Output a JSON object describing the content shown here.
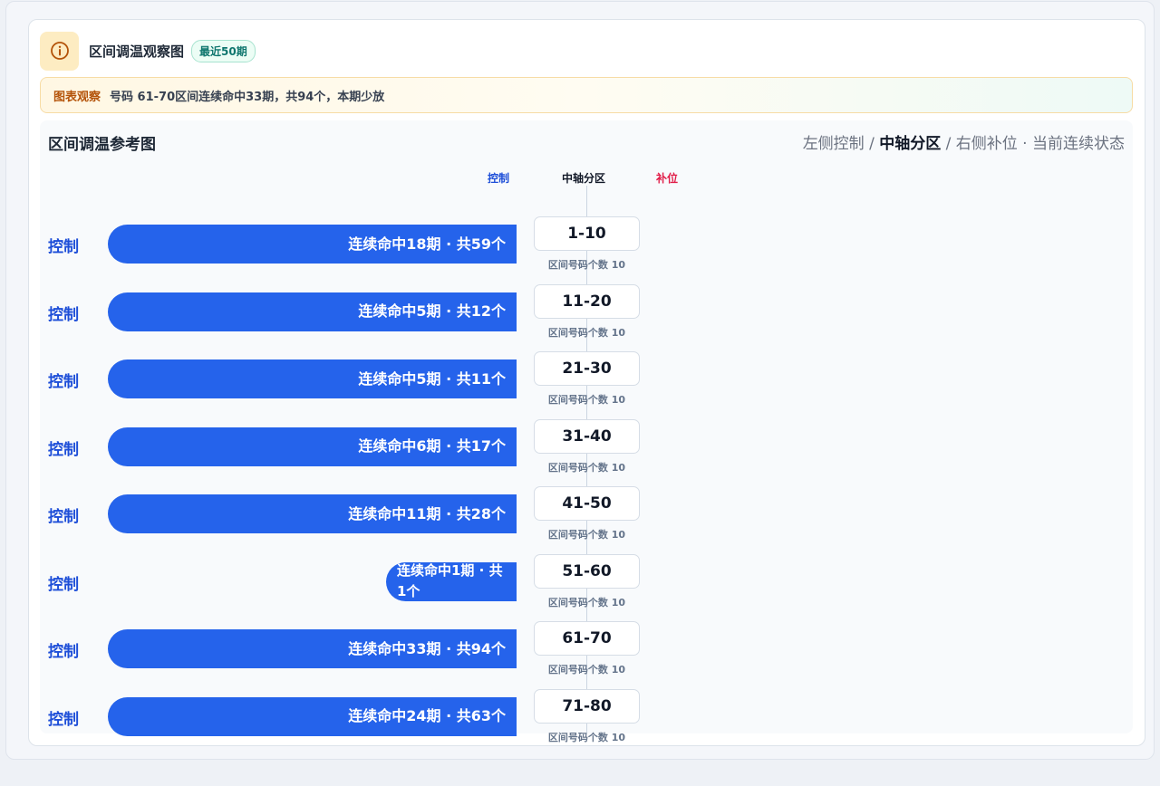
{
  "header": {
    "title": "区间调温观察图",
    "badge": "最近50期",
    "icon": "info-icon"
  },
  "observation": {
    "tag": "图表观察",
    "text": "号码 61-70区间连续命中33期，共94个，本期少放"
  },
  "panel": {
    "title": "区间调温参考图",
    "legend": {
      "left": "左侧控制",
      "sep1": " / ",
      "mid": "中轴分区",
      "sep2": " / ",
      "right": "右侧补位",
      "dot": " · ",
      "state": "当前连续状态"
    },
    "columns": {
      "left": "控制",
      "mid": "中轴分区",
      "right": "补位"
    }
  },
  "colors": {
    "control": "#2563eb",
    "control_text": "#1d4ed8",
    "fill": "#e11d48"
  },
  "rows": [
    {
      "label": "控制",
      "bar_text": "连续命中18期 · 共59个",
      "periods": 18,
      "range": "1-10",
      "count_text": "区间号码个数 10"
    },
    {
      "label": "控制",
      "bar_text": "连续命中5期 · 共12个",
      "periods": 5,
      "range": "11-20",
      "count_text": "区间号码个数 10"
    },
    {
      "label": "控制",
      "bar_text": "连续命中5期 · 共11个",
      "periods": 5,
      "range": "21-30",
      "count_text": "区间号码个数 10"
    },
    {
      "label": "控制",
      "bar_text": "连续命中6期 · 共17个",
      "periods": 6,
      "range": "31-40",
      "count_text": "区间号码个数 10"
    },
    {
      "label": "控制",
      "bar_text": "连续命中11期 · 共28个",
      "periods": 11,
      "range": "41-50",
      "count_text": "区间号码个数 10"
    },
    {
      "label": "控制",
      "bar_text": "连续命中1期 · 共1个",
      "periods": 1,
      "range": "51-60",
      "count_text": "区间号码个数 10"
    },
    {
      "label": "控制",
      "bar_text": "连续命中33期 · 共94个",
      "periods": 33,
      "range": "61-70",
      "count_text": "区间号码个数 10"
    },
    {
      "label": "控制",
      "bar_text": "连续命中24期 · 共63个",
      "periods": 24,
      "range": "71-80",
      "count_text": "区间号码个数 10"
    }
  ]
}
